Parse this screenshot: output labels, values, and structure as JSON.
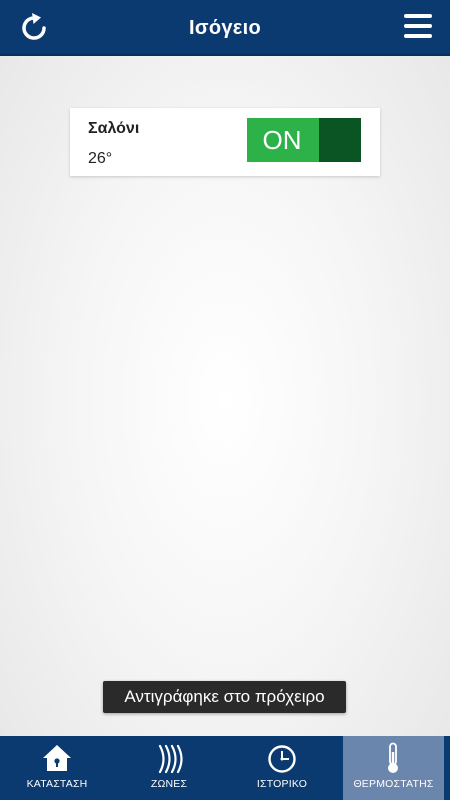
{
  "header": {
    "title": "Ισόγειο",
    "refresh_icon": "refresh-icon",
    "menu_icon": "hamburger-menu-icon"
  },
  "zones": [
    {
      "name": "Σαλόνι",
      "temperature": "26°",
      "toggle_label": "ON",
      "toggle_state": "on"
    }
  ],
  "toast": {
    "message": "Αντιγράφηκε στο πρόχειρο"
  },
  "bottom_nav": {
    "items": [
      {
        "label": "ΚΑΤΑΣΤΑΣΗ",
        "icon": "home-icon",
        "active": false
      },
      {
        "label": "ΖΩΝΕΣ",
        "icon": "signal-waves-icon",
        "active": false
      },
      {
        "label": "ΙΣΤΟΡΙΚΟ",
        "icon": "clock-icon",
        "active": false
      },
      {
        "label": "ΘΕΡΜΟΣΤΑΤΗΣ",
        "icon": "thermometer-icon",
        "active": true
      }
    ]
  },
  "colors": {
    "header_bg": "#0b3a70",
    "toggle_on": "#2db24a",
    "toggle_knob": "#0b5524",
    "nav_active": "#6b86ad"
  }
}
